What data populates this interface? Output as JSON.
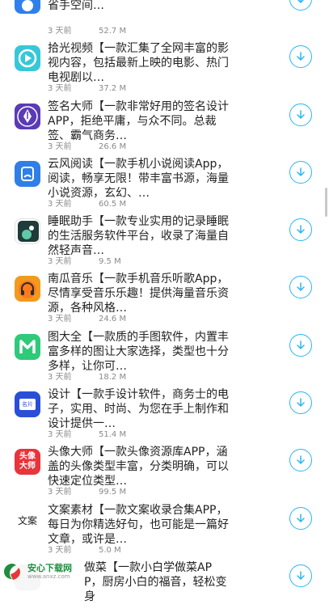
{
  "items": [
    {
      "title": "文件信息，从而快速清除垃圾文件节省手空间…",
      "time": "3 天前",
      "size": "52.7 M",
      "icon": "cleaner-icon"
    },
    {
      "title": "拾光视频【一款汇集了全网丰富的影视内容，包括最新上映的电影、热门电视剧以…",
      "time": "3 天前",
      "size": "37.2 M",
      "icon": "video-play-icon"
    },
    {
      "title": "签名大师【一款非常好用的签名设计APP，拒绝平庸，与众不同。总裁签、霸气商务…",
      "time": "3 天前",
      "size": "26.6 M",
      "icon": "pen-nib-icon"
    },
    {
      "title": "云风阅读【一款手机小说阅读App，阅读，畅享无限！带丰富书源，海量小说资源，玄幻、…",
      "time": "3 天前",
      "size": "60.5 M",
      "icon": "reader-icon"
    },
    {
      "title": "睡眠助手【一款专业实用的记录睡眠的生活服务软件平台，收录了海量自然轻声音…",
      "time": "3 天前",
      "size": "9.5 M",
      "icon": "sleep-icon"
    },
    {
      "title": "南瓜音乐【一款手机音乐听歌App，尽情享受音乐乐趣！提供海量音乐资源，各种风格…",
      "time": "3 天前",
      "size": "24.6 M",
      "icon": "headphones-icon"
    },
    {
      "title": "图大全【一款质的手图软件，内置丰富多样的图让大家选择，类型也十分多样，让你可…",
      "time": "3 天前",
      "size": "18.2 M",
      "icon": "m-letter-icon"
    },
    {
      "title": "设计【一款手设计软件，商务士的电子，实用、时尚、为您在手上制作和设计提供一…",
      "time": "3 天前",
      "size": "51.4 M",
      "icon": "card-design-icon"
    },
    {
      "title": "头像大师【一款头像资源库APP，涵盖的头像类型丰富，分类明确，可以快速定位类型…",
      "time": "3 天前",
      "size": "99.5 M",
      "icon": "avatar-master-icon"
    },
    {
      "title": "文案素材【一款文案收录合集APP，每日为你精选好句，也可能是一篇好文章，或许是…",
      "time": "3 天前",
      "size": "5.0 M",
      "icon": "copywriting-icon"
    },
    {
      "title": "做菜【一款小白学做菜APP，厨房小白的福音，轻松变身",
      "time": "",
      "size": "",
      "icon": "cooking-icon"
    }
  ],
  "icon_text": {
    "design_card": "名片",
    "avatar_master": "头像\n大师",
    "copywriting": "文案"
  },
  "watermark": {
    "title": "安心下载网",
    "url": "www.anxz.com"
  },
  "colors": {
    "accent": "#29b6f6"
  }
}
